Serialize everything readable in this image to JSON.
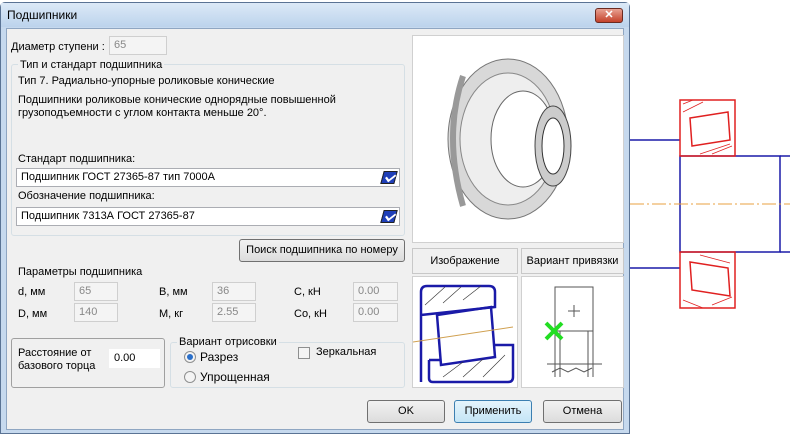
{
  "dialog": {
    "title": "Подшипники",
    "close": "✕"
  },
  "step_diameter": {
    "label": "Диаметр ступени :",
    "value": "65"
  },
  "type_group": {
    "title": "Тип и стандарт подшипника",
    "type_line": "Тип 7. Радиально-упорные роликовые конические",
    "description_1": "Подшипники роликовые конические однорядные повышенной",
    "description_2": "грузоподъемности с углом контакта меньше 20°.",
    "standard_label": "Стандарт подшипника:",
    "standard_value": "Подшипник ГОСТ 27365-87 тип 7000А",
    "designation_label": "Обозначение подшипника:",
    "designation_value": "Подшипник 7313А ГОСТ 27365-87"
  },
  "search_button": "Поиск подшипника по номеру",
  "params": {
    "title": "Параметры подшипника",
    "d_label": "d, мм",
    "d_value": "65",
    "D_label": "D, мм",
    "D_value": "140",
    "B_label": "B, мм",
    "B_value": "36",
    "M_label": "M, кг",
    "M_value": "2.55",
    "C_label": "C, кН",
    "C_value": "0.00",
    "Co_label": "Co, кН",
    "Co_value": "0.00"
  },
  "distance": {
    "label_1": "Расстояние от",
    "label_2": "базового торца",
    "value": "0.00"
  },
  "drawing_variant": {
    "title": "Вариант отрисовки",
    "option_section": "Разрез",
    "option_simplified": "Упрощенная",
    "selected": "Разрез",
    "mirror_label": "Зеркальная",
    "mirror_checked": false
  },
  "tabs": {
    "image": "Изображение",
    "anchor": "Вариант привязки"
  },
  "buttons": {
    "ok": "OK",
    "apply": "Применить",
    "cancel": "Отмена"
  },
  "colors": {
    "cad_red": "#e02020",
    "cad_blue": "#1a1aa8",
    "snap_green": "#22dd22"
  }
}
